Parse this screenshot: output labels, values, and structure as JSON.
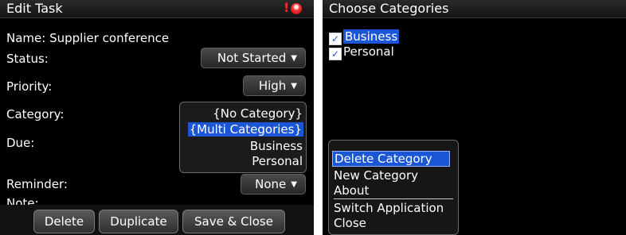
{
  "edit_task": {
    "title": "Edit Task",
    "name_line": "Name: Supplier conference",
    "status_label": "Status:",
    "status_value": "Not Started",
    "priority_label": "Priority:",
    "priority_value": "High",
    "category_label": "Category:",
    "due_label": "Due:",
    "reminder_label": "Reminder:",
    "reminder_value": "None",
    "notes_label": "Note:",
    "category_options": [
      "{No Category}",
      "{Multi Categories}",
      "Business",
      "Personal"
    ],
    "buttons": {
      "delete": "Delete",
      "duplicate": "Duplicate",
      "save_close": "Save & Close"
    }
  },
  "choose_categories": {
    "title": "Choose Categories",
    "items": [
      {
        "label": "Business",
        "checked": true
      },
      {
        "label": "Personal",
        "checked": true
      }
    ],
    "menu": [
      "Delete Category",
      "New Category",
      "About",
      "Switch Application",
      "Close"
    ]
  },
  "colors": {
    "background": "#000000",
    "selection": "#1a56d6",
    "alert_red": "#ff2a2a"
  }
}
